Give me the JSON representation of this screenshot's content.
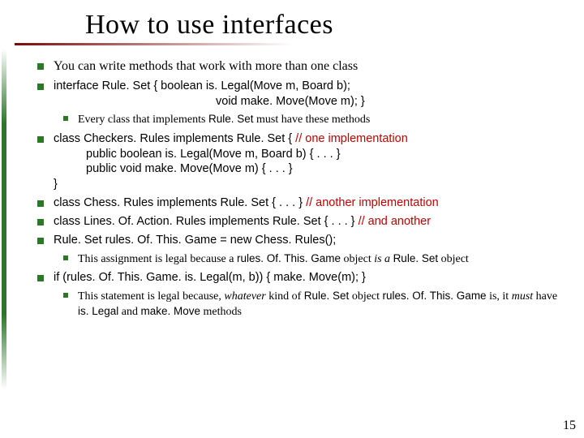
{
  "title": "How to use interfaces",
  "b1": "You can write methods that work with more than one class",
  "b2a": "interface Rule. Set { boolean is. Legal(Move m, Board b);",
  "b2b": "void make. Move(Move m); }",
  "b2s_a": "Every class that implements ",
  "b2s_code": "Rule. Set",
  "b2s_b": " must have these methods",
  "b3l1": "class Checkers. Rules implements Rule. Set { ",
  "b3l1c": "// one implementation",
  "b3l2": "public boolean is. Legal(Move m, Board b) { . . . }",
  "b3l3": "public void make. Move(Move m) { . . . }",
  "b3l4": "}",
  "b4a": "class Chess. Rules implements Rule. Set { . . . } ",
  "b4c": "// another implementation",
  "b5a": "class Lines. Of. Action. Rules implements Rule. Set { . . . } ",
  "b5c": "// and another",
  "b6": "Rule. Set rules. Of. This. Game = new Chess. Rules();",
  "b6s_a": "This assignment is legal because a ",
  "b6s_code1": "rules. Of. This. Game",
  "b6s_mid": " object ",
  "b6s_isa": "is a",
  "b6s_space": " ",
  "b6s_code2": "Rule. Set",
  "b6s_b": " object",
  "b7": "if (rules. Of. This. Game. is. Legal(m, b)) { make. Move(m); }",
  "b7s_a": "This statement is legal because, ",
  "b7s_i1": "whatever",
  "b7s_b": " kind of ",
  "b7s_code1": "Rule. Set",
  "b7s_c": " object ",
  "b7s_code2": "rules. Of. This. Game",
  "b7s_d": " is, it ",
  "b7s_i2": "must",
  "b7s_e": " have ",
  "b7s_code3": "is. Legal",
  "b7s_f": " and ",
  "b7s_code4": "make. Move",
  "b7s_g": " methods",
  "pagenum": "15"
}
